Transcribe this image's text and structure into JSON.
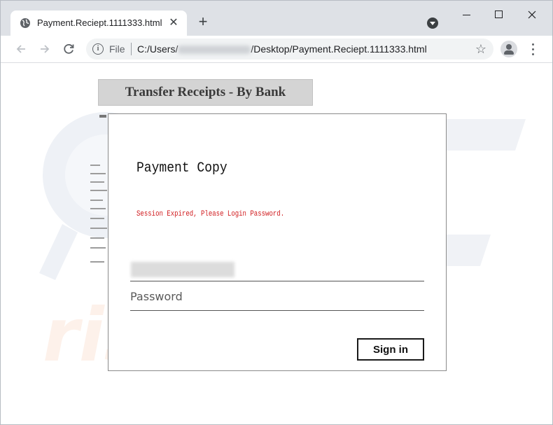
{
  "browser": {
    "tab": {
      "title": "Payment.Reciept.1111333.html",
      "icon": "globe-icon"
    },
    "new_tab_symbol": "+",
    "address": {
      "scheme_label": "File",
      "url_prefix": "C:/Users/",
      "url_suffix": "/Desktop/Payment.Reciept.1111333.html"
    },
    "icons": {
      "back": "back-arrow-icon",
      "forward": "forward-arrow-icon",
      "reload": "reload-icon",
      "bookmark": "star-icon",
      "profile": "profile-icon",
      "menu": "kebab-menu-icon"
    }
  },
  "page": {
    "background_heading": "Transfer Receipts - By Bank",
    "dialog": {
      "heading": "Payment Copy",
      "error_message": "Session Expired, Please Login Password.",
      "password_placeholder": "Password",
      "signin_label": "Sign in"
    }
  },
  "colors": {
    "error": "#d0191c",
    "tabstrip": "#dee1e6",
    "omnibox": "#f1f3f4"
  }
}
